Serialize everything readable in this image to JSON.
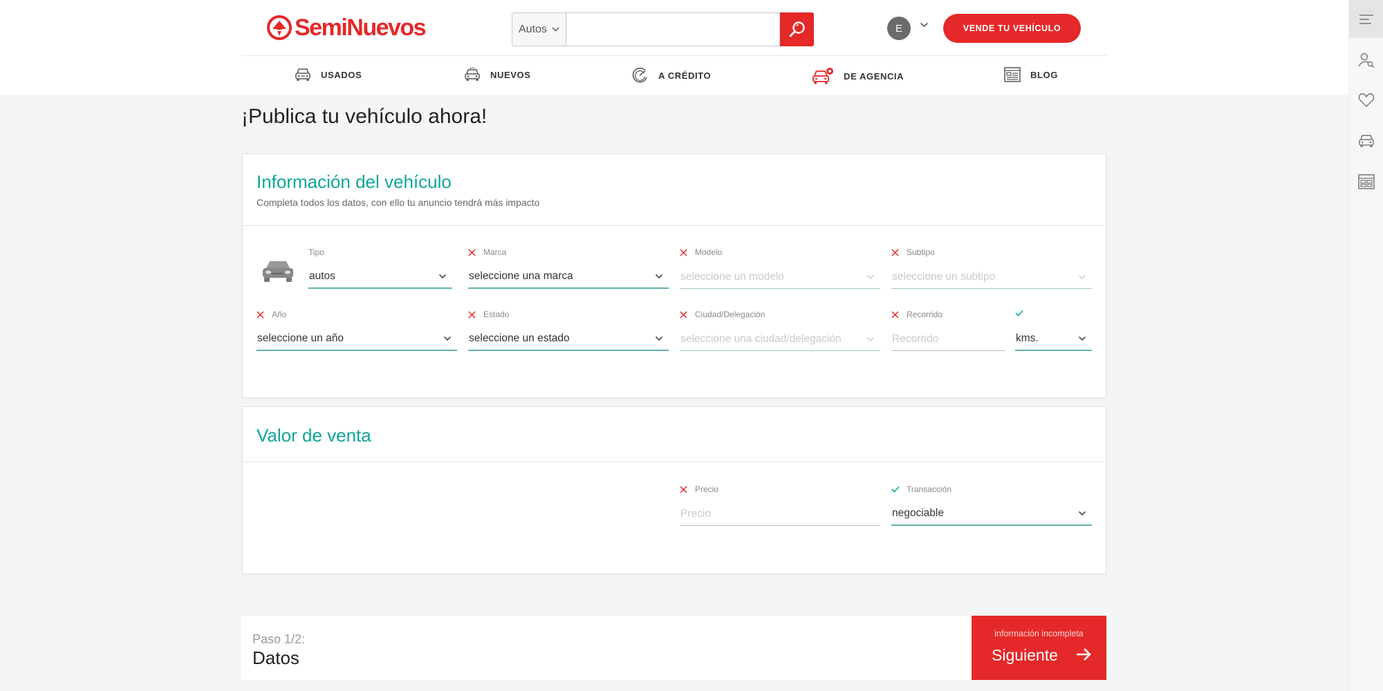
{
  "brand": {
    "name": "SemiNuevos",
    "accent": "#e52829",
    "teal": "#0ea69a"
  },
  "search": {
    "type_value": "Autos",
    "placeholder": ""
  },
  "user": {
    "initial": "E"
  },
  "header": {
    "sell_label": "VENDE TU VEHÍCULO"
  },
  "nav": {
    "items": [
      {
        "label": "USADOS",
        "icon": "car-front-icon"
      },
      {
        "label": "NUEVOS",
        "icon": "car-sparkle-icon"
      },
      {
        "label": "A CRÉDITO",
        "icon": "credit-gauge-icon"
      },
      {
        "label": "DE AGENCIA",
        "icon": "dealer-car-icon"
      },
      {
        "label": "BLOG",
        "icon": "news-icon"
      }
    ]
  },
  "sidebar": {
    "icons": [
      "menu-icon",
      "user-search-icon",
      "heart-icon",
      "car-icon",
      "dashboard-icon"
    ]
  },
  "page": {
    "title": "¡Publica tu vehículo ahora!"
  },
  "vehicle_info": {
    "title": "Información del vehículo",
    "subtitle": "Completa todos los datos, con ello tu anuncio tendrá más impacto",
    "fields": {
      "tipo": {
        "label": "Tipo",
        "value": "autos"
      },
      "marca": {
        "label": "Marca",
        "value": "seleccione una marca"
      },
      "modelo": {
        "label": "Modelo",
        "value": "seleccione un modelo"
      },
      "subtipo": {
        "label": "Subtipo",
        "value": "seleccione un subtipo"
      },
      "anio": {
        "label": "Año",
        "value": "seleccione un año"
      },
      "estado": {
        "label": "Estado",
        "value": "seleccione un estado"
      },
      "ciudad": {
        "label": "Ciudad/Delegación",
        "value": "seleccione una ciudad/delegación"
      },
      "recorrido": {
        "label": "Recorrido",
        "placeholder": "Recorrido"
      },
      "unidad": {
        "label": "",
        "value": "kms."
      }
    }
  },
  "sale_value": {
    "title": "Valor de venta",
    "fields": {
      "precio": {
        "label": "Precio",
        "placeholder": "Precio"
      },
      "transaccion": {
        "label": "Transacción",
        "value": "negociable"
      }
    }
  },
  "footer": {
    "step": "Paso 1/2:",
    "step_name": "Datos",
    "next_status": "información incompleta",
    "next_label": "Siguiente"
  }
}
